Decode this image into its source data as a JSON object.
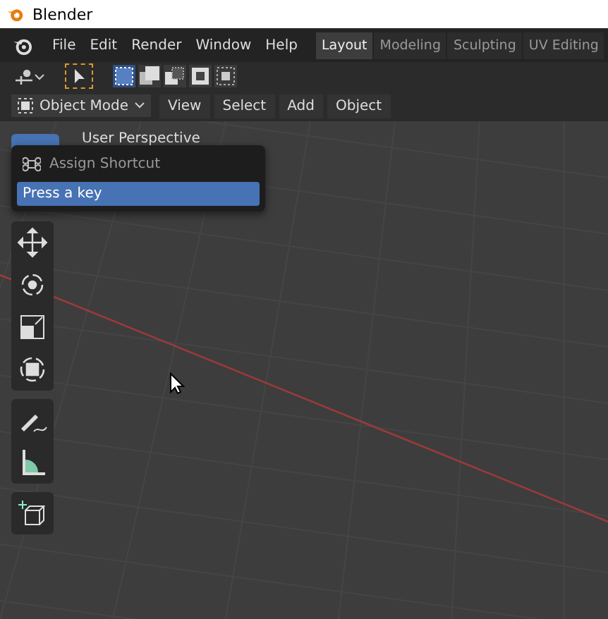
{
  "window": {
    "title": "Blender"
  },
  "menu": [
    "File",
    "Edit",
    "Render",
    "Window",
    "Help"
  ],
  "workspace_tabs": [
    {
      "label": "Layout",
      "selected": true
    },
    {
      "label": "Modeling",
      "selected": false
    },
    {
      "label": "Sculpting",
      "selected": false
    },
    {
      "label": "UV Editing",
      "selected": false
    }
  ],
  "select_modes": [
    {
      "kind": "set",
      "selected": true
    },
    {
      "kind": "extend",
      "selected": false
    },
    {
      "kind": "subtract",
      "selected": false
    },
    {
      "kind": "difference",
      "selected": false
    },
    {
      "kind": "intersect",
      "selected": false
    }
  ],
  "header": {
    "mode": "Object Mode",
    "menus": [
      "View",
      "Select",
      "Add",
      "Object"
    ]
  },
  "viewport": {
    "label": "User Perspective"
  },
  "popup": {
    "items": [
      {
        "kind": "command",
        "label": "Assign Shortcut",
        "selected": false
      },
      {
        "kind": "prompt",
        "label": "Press a key",
        "selected": true
      }
    ]
  },
  "toolbar": [
    {
      "tools": [
        {
          "kind": "move"
        },
        {
          "kind": "rotate"
        },
        {
          "kind": "scale"
        },
        {
          "kind": "transform"
        }
      ]
    },
    {
      "tools": [
        {
          "kind": "annotate"
        },
        {
          "kind": "measure"
        }
      ]
    },
    {
      "tools": [
        {
          "kind": "add-cube"
        }
      ]
    }
  ]
}
